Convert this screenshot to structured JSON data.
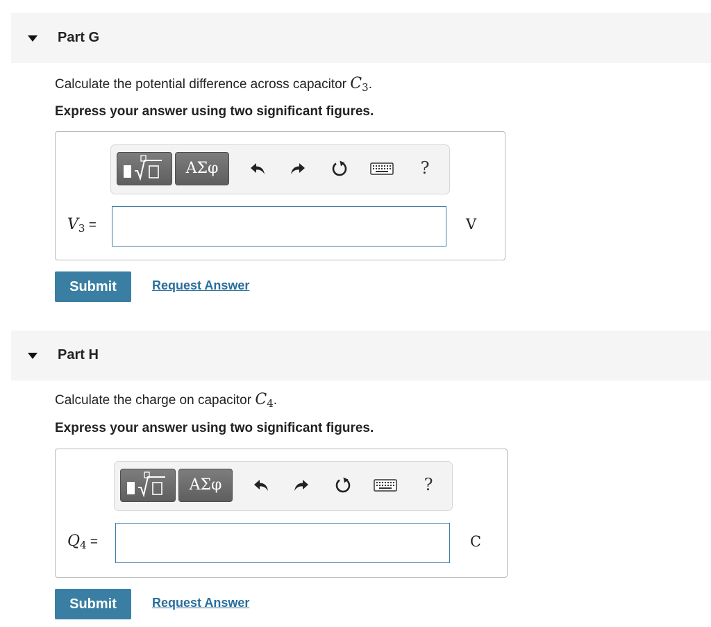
{
  "parts": [
    {
      "title": "Part G",
      "prompt_text": "Calculate the potential difference across capacitor ",
      "prompt_var": "C",
      "prompt_sub": "3",
      "prompt_end": ".",
      "instruction": "Express your answer using two significant figures.",
      "toolbar": {
        "templates_icon": "templates-icon",
        "greek_label": "ΑΣφ",
        "undo_icon": "undo-icon",
        "redo_icon": "redo-icon",
        "reset_icon": "reset-icon",
        "keyboard_icon": "keyboard-icon",
        "help_label": "?"
      },
      "var_name": "V",
      "var_sub": "3",
      "equals": "=",
      "input_value": "",
      "unit": "V",
      "submit_label": "Submit",
      "request_label": "Request Answer"
    },
    {
      "title": "Part H",
      "prompt_text": "Calculate the charge on capacitor ",
      "prompt_var": "C",
      "prompt_sub": "4",
      "prompt_end": ".",
      "instruction": "Express your answer using two significant figures.",
      "toolbar": {
        "templates_icon": "templates-icon",
        "greek_label": "ΑΣφ",
        "undo_icon": "undo-icon",
        "redo_icon": "redo-icon",
        "reset_icon": "reset-icon",
        "keyboard_icon": "keyboard-icon",
        "help_label": "?"
      },
      "var_name": "Q",
      "var_sub": "4",
      "equals": "=",
      "input_value": "",
      "unit": "C",
      "submit_label": "Submit",
      "request_label": "Request Answer"
    }
  ],
  "colors": {
    "header_bg": "#f5f5f5",
    "submit_bg": "#3a7fa3",
    "link": "#2a6e9c",
    "input_border": "#3a7ca5"
  }
}
